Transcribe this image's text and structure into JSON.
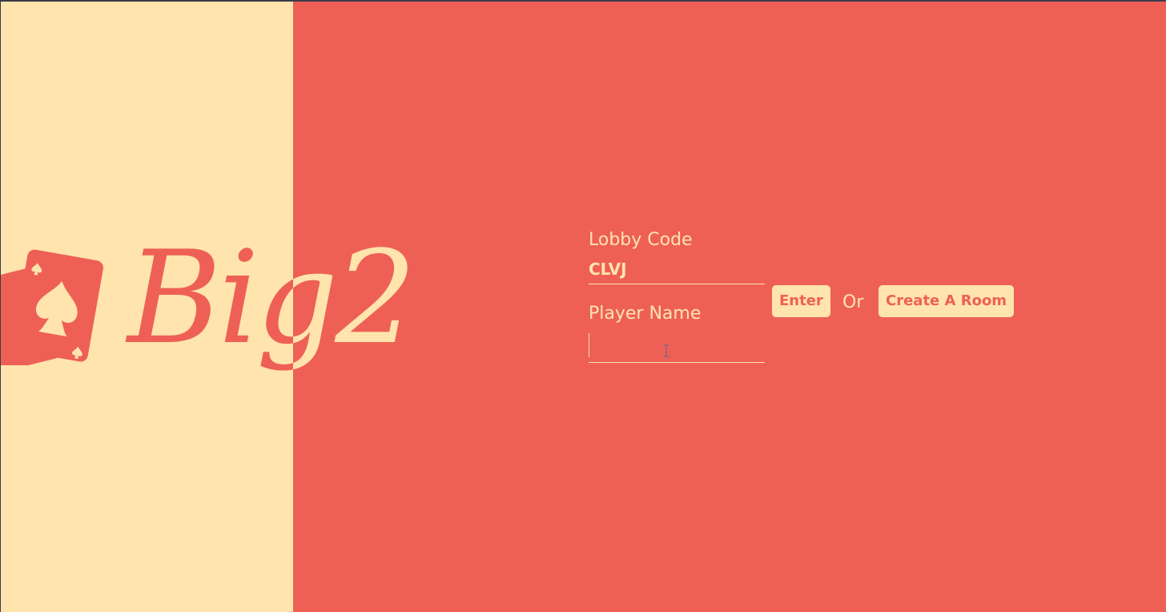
{
  "app": {
    "logo_text": "Big2",
    "colors": {
      "accent": "#ee6055",
      "cream": "#ffe4ad"
    }
  },
  "form": {
    "lobby_label": "Lobby Code",
    "lobby_value": "CLVJ",
    "enter_label": "Enter",
    "or_text": "Or",
    "create_label": "Create A Room",
    "player_label": "Player Name",
    "player_value": ""
  },
  "icons": {
    "logo_icon": "playing-cards-spade-icon",
    "cursor": "text-ibeam-cursor"
  }
}
